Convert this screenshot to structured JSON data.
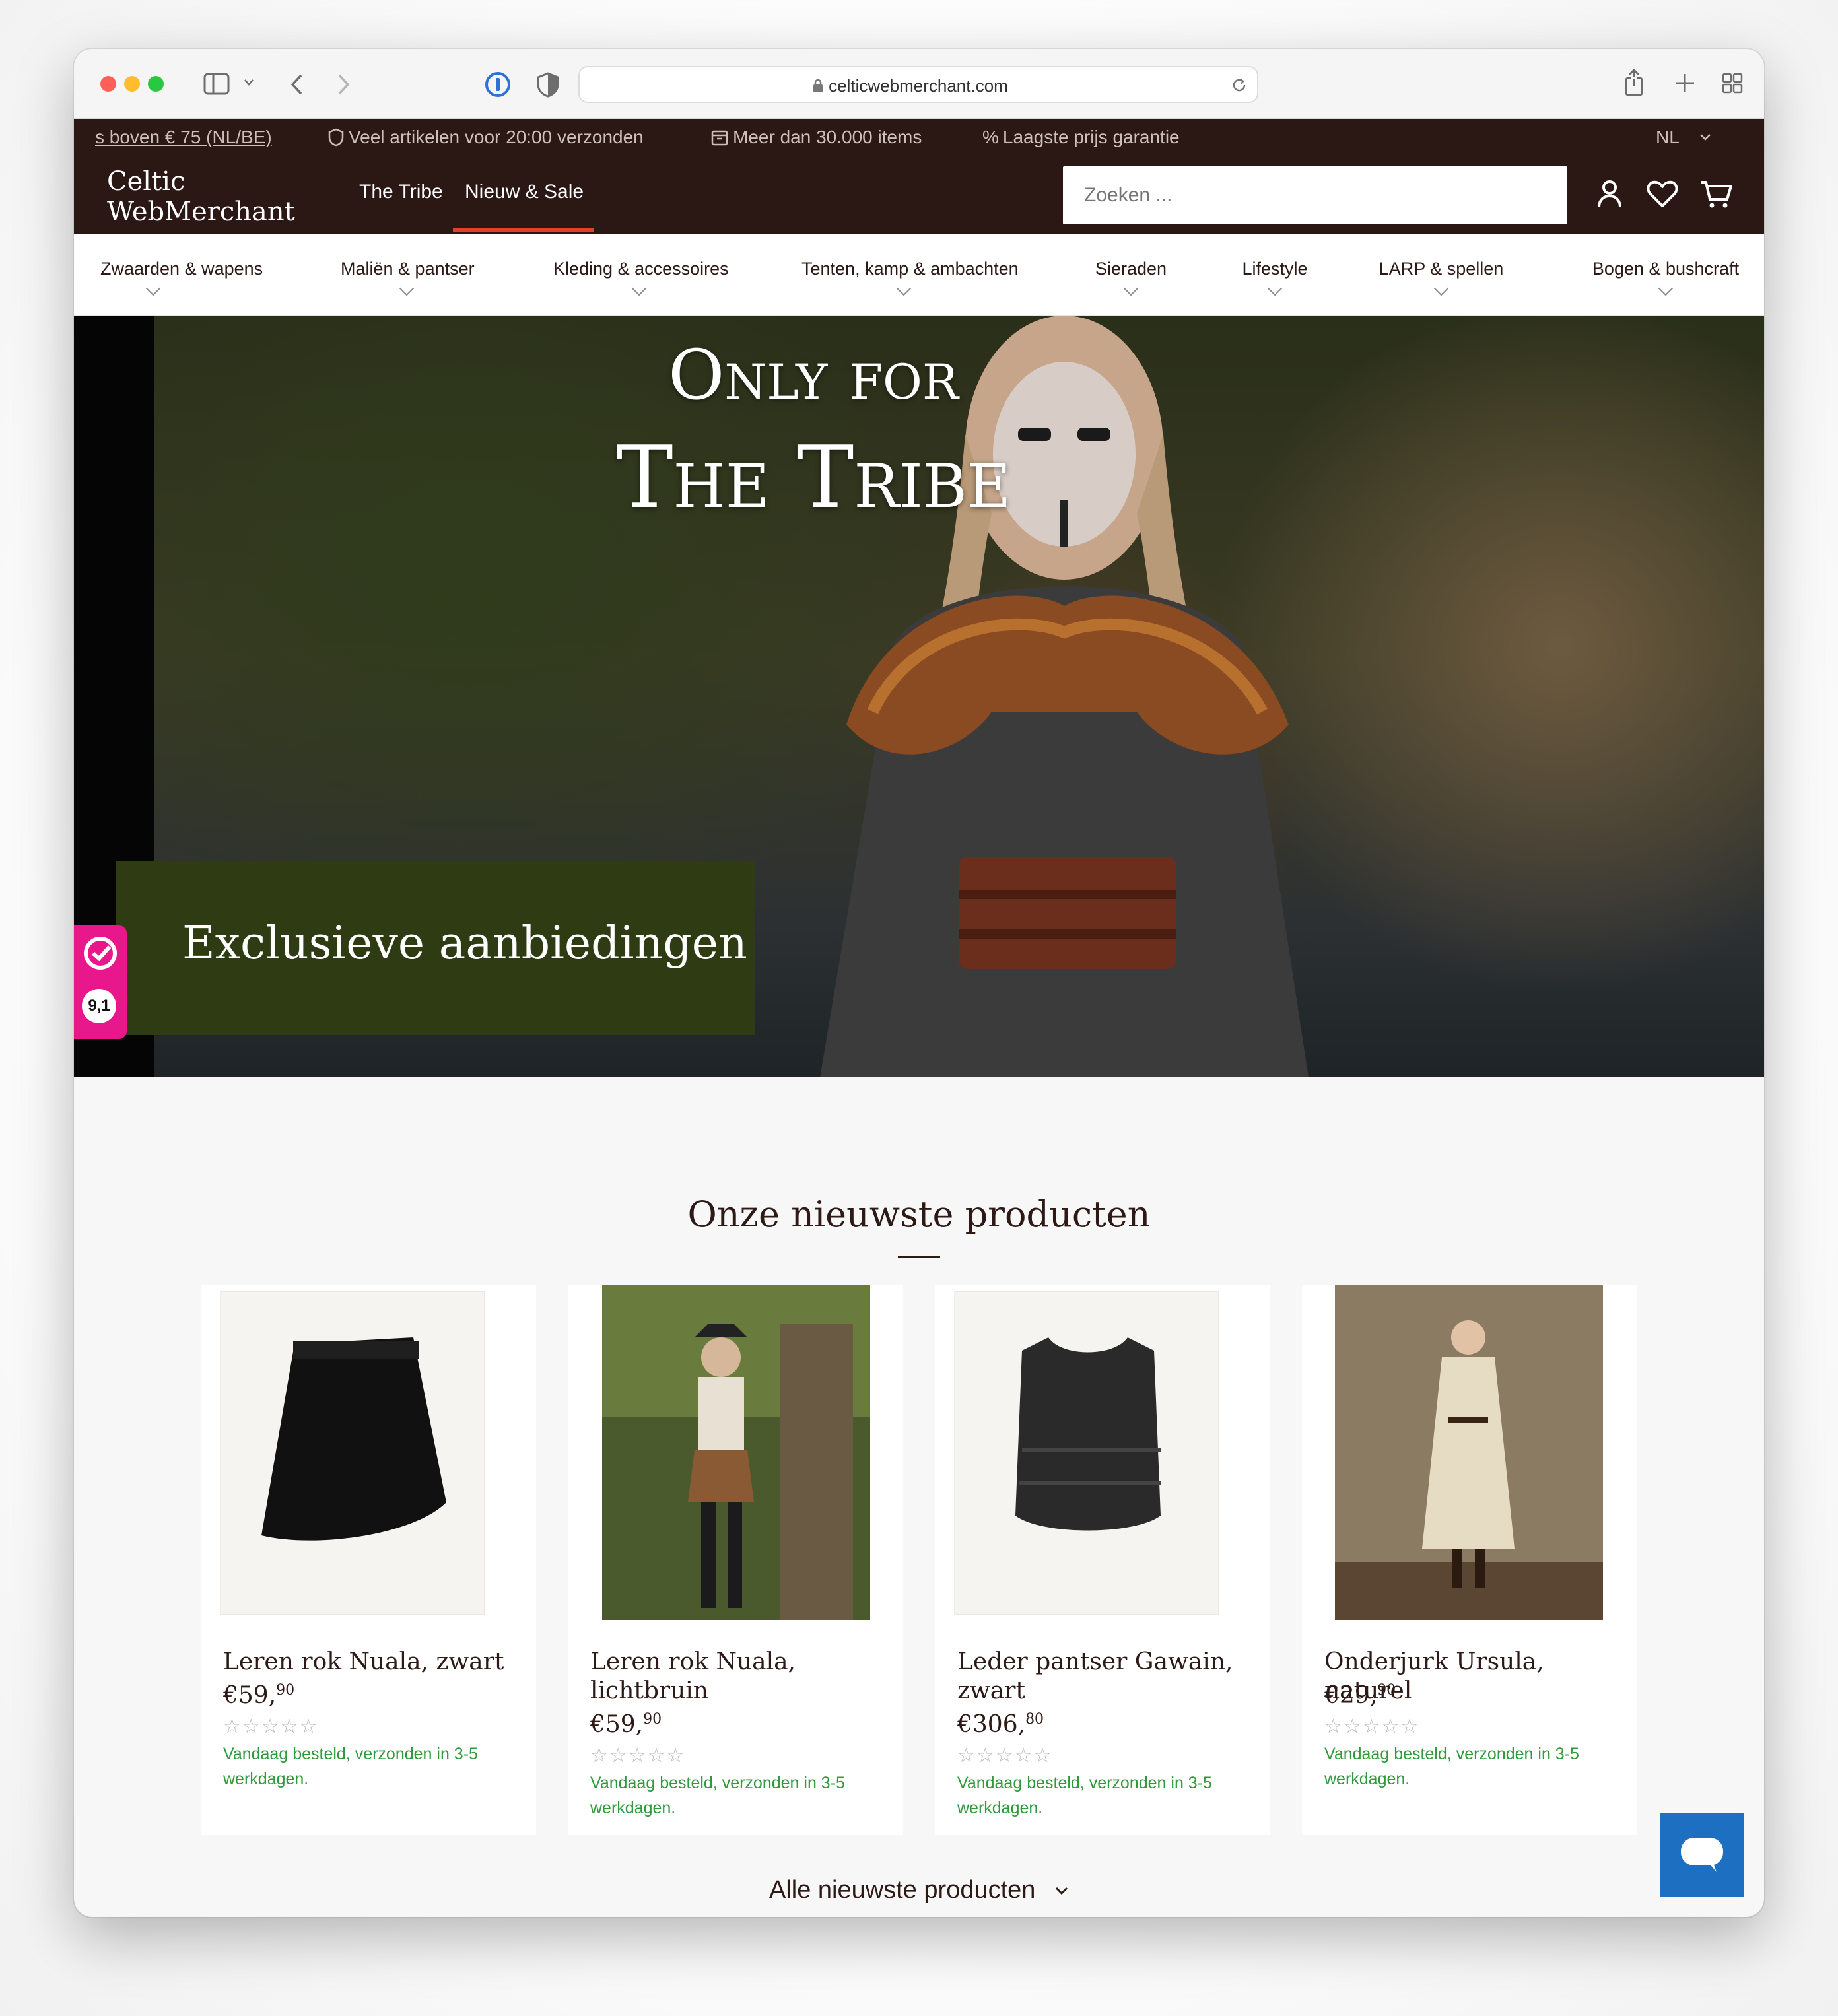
{
  "browser": {
    "url": "celticwebmerchant.com"
  },
  "promo_strip": {
    "shipping": "s boven € 75 (NL/BE)",
    "dispatch": "Veel artikelen voor 20:00 verzonden",
    "items": "Meer dan 30.000 items",
    "price": "Laagste prijs garantie",
    "language": "NL"
  },
  "header": {
    "logo_line1": "Celtic",
    "logo_line2": "WebMerchant",
    "nav": [
      "The Tribe",
      "Nieuw & Sale"
    ],
    "search_placeholder": "Zoeken ..."
  },
  "categories": [
    "Zwaarden & wapens",
    "Maliën & pantser",
    "Kleding & accessoires",
    "Tenten, kamp & ambachten",
    "Sieraden",
    "Lifestyle",
    "LARP & spellen",
    "Bogen & bushcraft"
  ],
  "hero": {
    "title_line1": "Only for",
    "title_line2": "The Tribe",
    "cta": "Exclusieve aanbiedingen"
  },
  "review_widget": {
    "score": "9,1"
  },
  "products_section": {
    "title": "Onze nieuwste producten",
    "all_link": "Alle nieuwste producten"
  },
  "products": [
    {
      "name": "Leren rok Nuala, zwart",
      "price_main": "€59,",
      "price_cents": "90",
      "shipping": "Vandaag besteld, verzonden in 3-5 werkdagen."
    },
    {
      "name": "Leren rok Nuala, lichtbruin",
      "price_main": "€59,",
      "price_cents": "90",
      "shipping": "Vandaag besteld, verzonden in 3-5 werkdagen."
    },
    {
      "name": "Leder pantser Gawain, zwart",
      "price_main": "€306,",
      "price_cents": "80",
      "shipping": "Vandaag besteld, verzonden in 3-5 werkdagen."
    },
    {
      "name": "Onderjurk Ursula, naturel",
      "price_main": "€29,",
      "price_cents": "90",
      "shipping": "Vandaag besteld, verzonden in 3-5 werkdagen."
    }
  ],
  "colors": {
    "header_bg": "#2b1714",
    "accent_underline": "#e1402b",
    "hero_box": "#2e3b13",
    "shipping_green": "#2f9a3b",
    "review_pink": "#e8188c",
    "chat_blue": "#1d6fc1"
  }
}
